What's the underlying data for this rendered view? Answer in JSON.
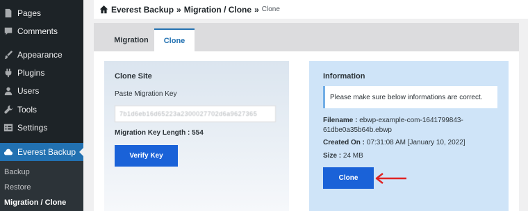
{
  "sidebar": {
    "items": [
      {
        "label": "Pages",
        "icon": "pages-icon"
      },
      {
        "label": "Comments",
        "icon": "comments-icon"
      },
      {
        "label": "Appearance",
        "icon": "appearance-icon"
      },
      {
        "label": "Plugins",
        "icon": "plugins-icon"
      },
      {
        "label": "Users",
        "icon": "users-icon"
      },
      {
        "label": "Tools",
        "icon": "tools-icon"
      },
      {
        "label": "Settings",
        "icon": "settings-icon"
      },
      {
        "label": "Everest Backup",
        "icon": "cloud-backup-icon",
        "active": true
      }
    ],
    "submenu": [
      {
        "label": "Backup"
      },
      {
        "label": "Restore"
      },
      {
        "label": "Migration / Clone",
        "current": true
      }
    ]
  },
  "header": {
    "icon": "home-icon",
    "title": "Everest Backup",
    "separator": "»",
    "section": "Migration / Clone",
    "current": "Clone"
  },
  "tabs": [
    {
      "label": "Migration",
      "active": false
    },
    {
      "label": "Clone",
      "active": true
    }
  ],
  "clone_site": {
    "title": "Clone Site",
    "key_label": "Paste Migration Key",
    "key_value": "7b1d6eb16d65223a2300027702d6a9627365",
    "length_text": "Migration Key Length : 554",
    "verify_label": "Verify Key"
  },
  "information": {
    "title": "Information",
    "notice": "Please make sure below informations are correct.",
    "filename_label": "Filename :",
    "filename_value_1": "ebwp-example-com-1641799843-",
    "filename_value_2": "61dbe0a35b64b.ebwp",
    "created_label": "Created On :",
    "created_value": "07:31:08 AM [January 10, 2022]",
    "size_label": "Size :",
    "size_value": "24 MB",
    "clone_label": "Clone"
  },
  "colors": {
    "accent": "#2271b1",
    "button": "#1a62d8",
    "arrow": "#e02424",
    "sidebar_bg": "#1d2327",
    "info_bg": "#cfe4f8"
  }
}
